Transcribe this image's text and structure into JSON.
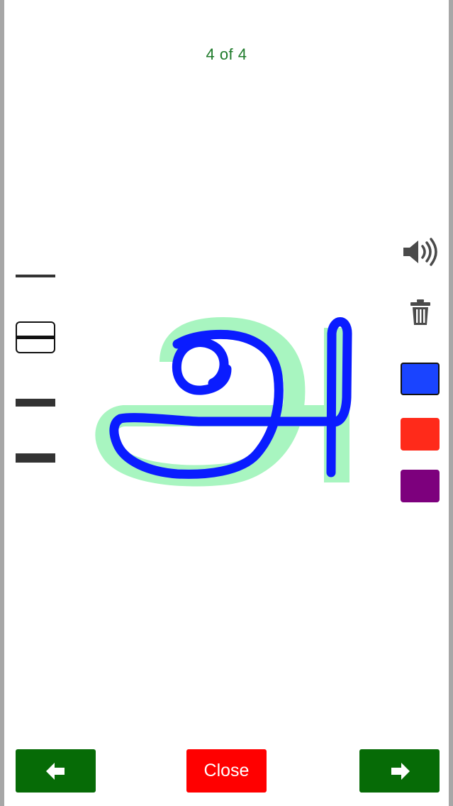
{
  "header": {
    "counter": "4 of 4"
  },
  "tools": {
    "line_styles": [
      "thin",
      "outlined",
      "medium",
      "thick"
    ],
    "icons": [
      "speaker-icon",
      "trash-icon"
    ]
  },
  "colors": {
    "swatches": [
      {
        "name": "blue",
        "hex": "#1a44ff",
        "selected": true
      },
      {
        "name": "red",
        "hex": "#ff2a1a",
        "selected": false
      },
      {
        "name": "purple",
        "hex": "#7d007d",
        "selected": false
      }
    ],
    "guide": "#a8f5c0",
    "stroke": "#0a1cff"
  },
  "footer": {
    "prev_icon": "arrow-left-icon",
    "close_label": "Close",
    "next_icon": "arrow-right-icon"
  }
}
